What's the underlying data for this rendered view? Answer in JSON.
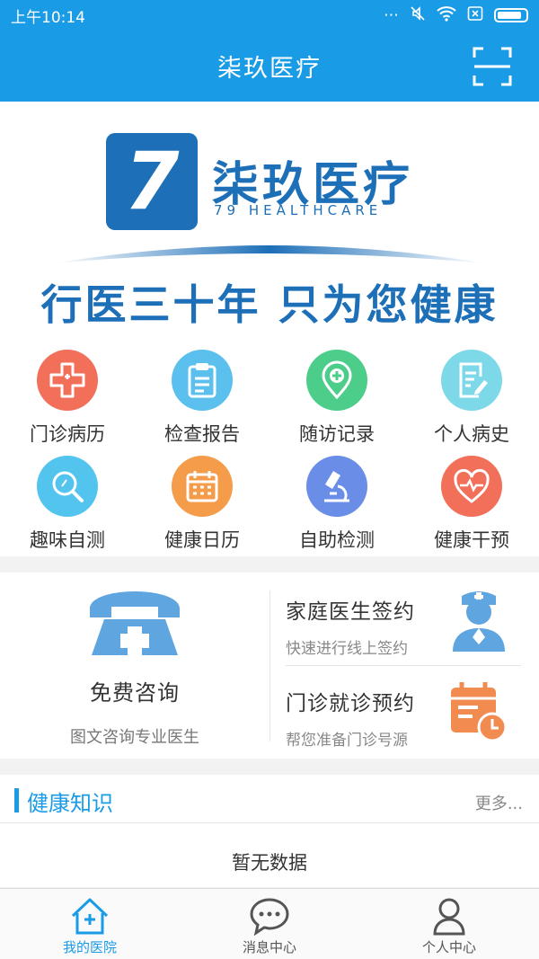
{
  "status_bar": {
    "time": "上午10:14",
    "icons": [
      "more-dots-icon",
      "mute-icon",
      "wifi-icon",
      "no-sim-icon",
      "battery-icon"
    ]
  },
  "header": {
    "title": "柒玖医疗",
    "scan_icon": "scan-icon"
  },
  "banner": {
    "logo_mark": "7",
    "logo_cn": "柒玖医疗",
    "logo_en": "79 HEALTHCARE",
    "slogan": "行医三十年  只为您健康",
    "brand_color": "#1d6fb8"
  },
  "grid": [
    {
      "label": "门诊病历",
      "icon": "hospital-cross-icon",
      "color": "#f2705a"
    },
    {
      "label": "检查报告",
      "icon": "clipboard-icon",
      "color": "#5cc0ee"
    },
    {
      "label": "随访记录",
      "icon": "location-cross-icon",
      "color": "#4cce8a"
    },
    {
      "label": "个人病史",
      "icon": "document-edit-icon",
      "color": "#7dd8e8"
    },
    {
      "label": "趣味自测",
      "icon": "magnifier-icon",
      "color": "#53c4ee"
    },
    {
      "label": "健康日历",
      "icon": "calendar-icon",
      "color": "#f59c4a"
    },
    {
      "label": "自助检测",
      "icon": "microscope-icon",
      "color": "#6a8ee8"
    },
    {
      "label": "健康干预",
      "icon": "heart-pulse-icon",
      "color": "#f2705a"
    }
  ],
  "services": {
    "consult": {
      "title": "免费咨询",
      "subtitle": "图文咨询专业医生",
      "icon": "telephone-icon"
    },
    "family_doctor": {
      "title": "家庭医生签约",
      "subtitle": "快速进行线上签约",
      "icon": "doctor-icon"
    },
    "appointment": {
      "title": "门诊就诊预约",
      "subtitle": "帮您准备门诊号源",
      "icon": "calendar-clock-icon"
    }
  },
  "knowledge": {
    "title": "健康知识",
    "more": "更多...",
    "empty": "暂无数据"
  },
  "tabs": [
    {
      "label": "我的医院",
      "icon": "home-hospital-icon",
      "active": true
    },
    {
      "label": "消息中心",
      "icon": "chat-bubble-icon",
      "active": false
    },
    {
      "label": "个人中心",
      "icon": "person-icon",
      "active": false
    }
  ],
  "colors": {
    "accent": "#1a9be6"
  }
}
